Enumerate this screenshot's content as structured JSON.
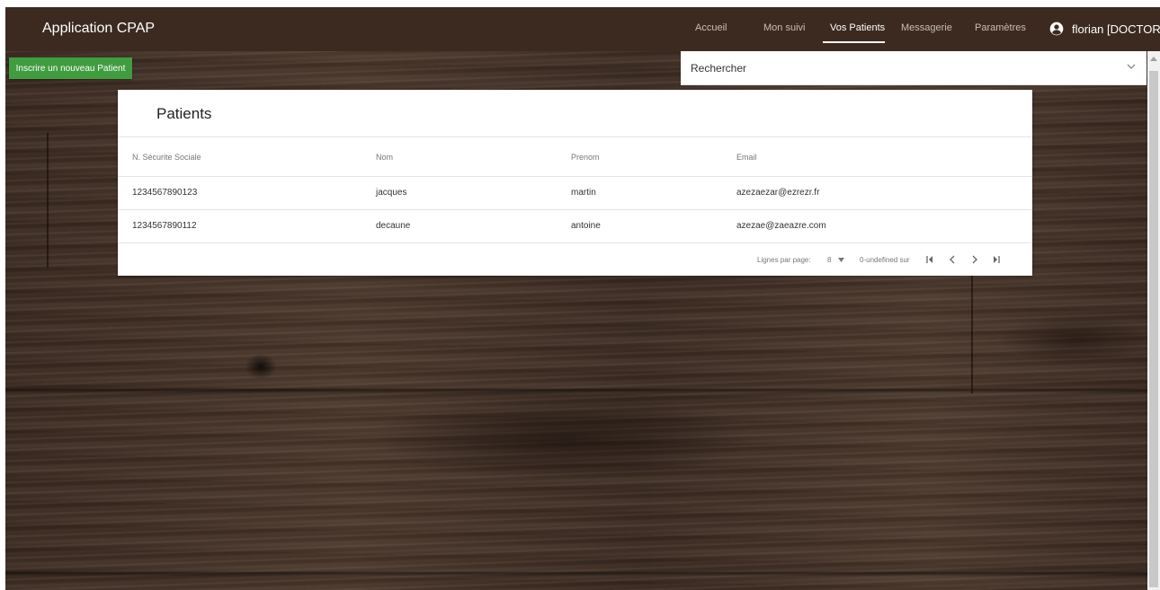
{
  "header": {
    "app_title": "Application CPAP",
    "nav": [
      {
        "label": "Accueil",
        "active": false
      },
      {
        "label": "Mon suivi",
        "active": false
      },
      {
        "label": "Vos Patients",
        "active": true
      },
      {
        "label": "Messagerie",
        "active": false
      },
      {
        "label": "Paramètres",
        "active": false
      }
    ],
    "user_label": "florian [DOCTOR]",
    "user_icon": "account-circle-icon"
  },
  "toolbar": {
    "new_patient_label": "Inscrire un nouveau Patient",
    "search_placeholder": "Rechercher",
    "search_icon": "chevron-down-icon"
  },
  "patients": {
    "title": "Patients",
    "columns": [
      "N. Sécurite Sociale",
      "Nom",
      "Prenom",
      "Email"
    ],
    "rows": [
      [
        "1234567890123",
        "jacques",
        "martin",
        "azezaezar@ezrezr.fr"
      ],
      [
        "1234567890112",
        "decaune",
        "antoine",
        "azezae@zaeazre.com"
      ]
    ],
    "pagination": {
      "rows_per_page_label": "Lignes par page:",
      "rows_per_page_value": "8",
      "range_text": "0-undefined sur"
    }
  },
  "colors": {
    "header_bg": "#3c2a20",
    "button_green": "#3f9d3f",
    "nav_active": "#ffffff"
  }
}
